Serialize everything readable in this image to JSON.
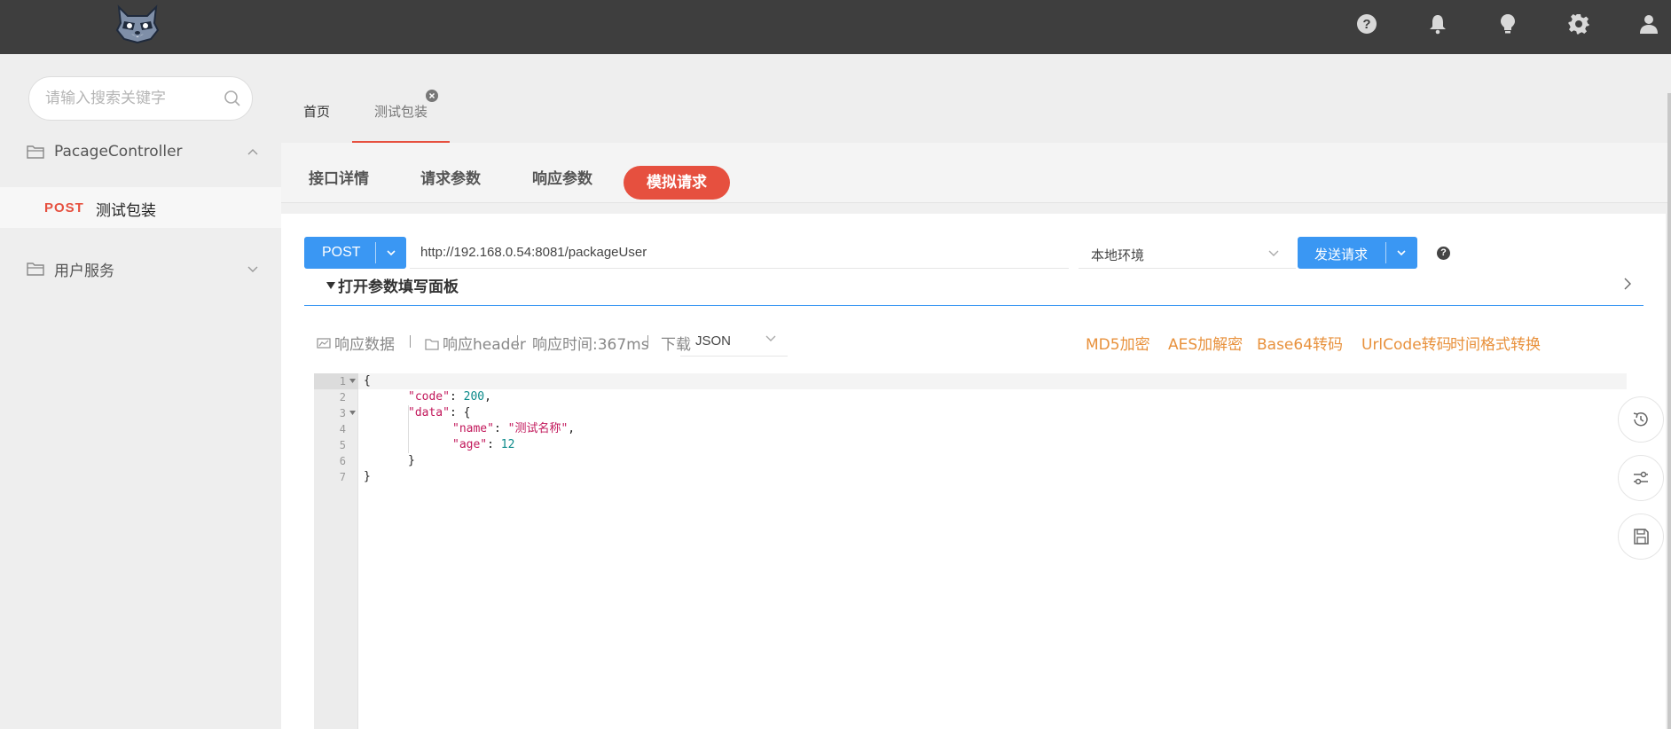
{
  "header": {
    "logo_name": "raccoon-logo",
    "icons": [
      "help-icon",
      "bell-icon",
      "lightbulb-icon",
      "gear-icon",
      "user-icon"
    ]
  },
  "sidebar": {
    "search_placeholder": "请输入搜索关键字",
    "groups": [
      {
        "label": "PacageController",
        "expanded": true,
        "items": [
          {
            "method": "POST",
            "name": "测试包装"
          }
        ]
      },
      {
        "label": "用户服务",
        "expanded": false
      }
    ]
  },
  "tabs": [
    {
      "label": "首页"
    },
    {
      "label": "测试包装"
    }
  ],
  "subtabs": [
    {
      "label": "接口详情"
    },
    {
      "label": "请求参数"
    },
    {
      "label": "响应参数"
    },
    {
      "label": "模拟请求"
    }
  ],
  "request": {
    "method": "POST",
    "url": "http://192.168.0.54:8081/packageUser",
    "environment": "本地环境",
    "send_label": "发送请求",
    "help": "?",
    "param_panel_label": "打开参数填写面板"
  },
  "response": {
    "data_label": "响应数据",
    "header_label": "响应header",
    "time_label": "响应时间:367ms",
    "download_label": "下载",
    "format": "JSON",
    "tools": [
      "MD5加密",
      "AES加解密",
      "Base64转码",
      "UrlCode转码",
      "时间格式转换"
    ]
  },
  "editor": {
    "lines": [
      "1",
      "2",
      "3",
      "4",
      "5",
      "6",
      "7"
    ],
    "code": {
      "brace_open": "{",
      "code_key": "\"code\"",
      "code_val": "200",
      "data_key": "\"data\"",
      "name_key": "\"name\"",
      "name_val": "\"测试名称\"",
      "age_key": "\"age\"",
      "age_val": "12",
      "inner_close": "}",
      "brace_close": "}"
    }
  },
  "colors": {
    "topbar": "#3e3e3e",
    "primary": "#3a97f3",
    "accent": "#e6503f",
    "tool_link": "#e8913c"
  }
}
